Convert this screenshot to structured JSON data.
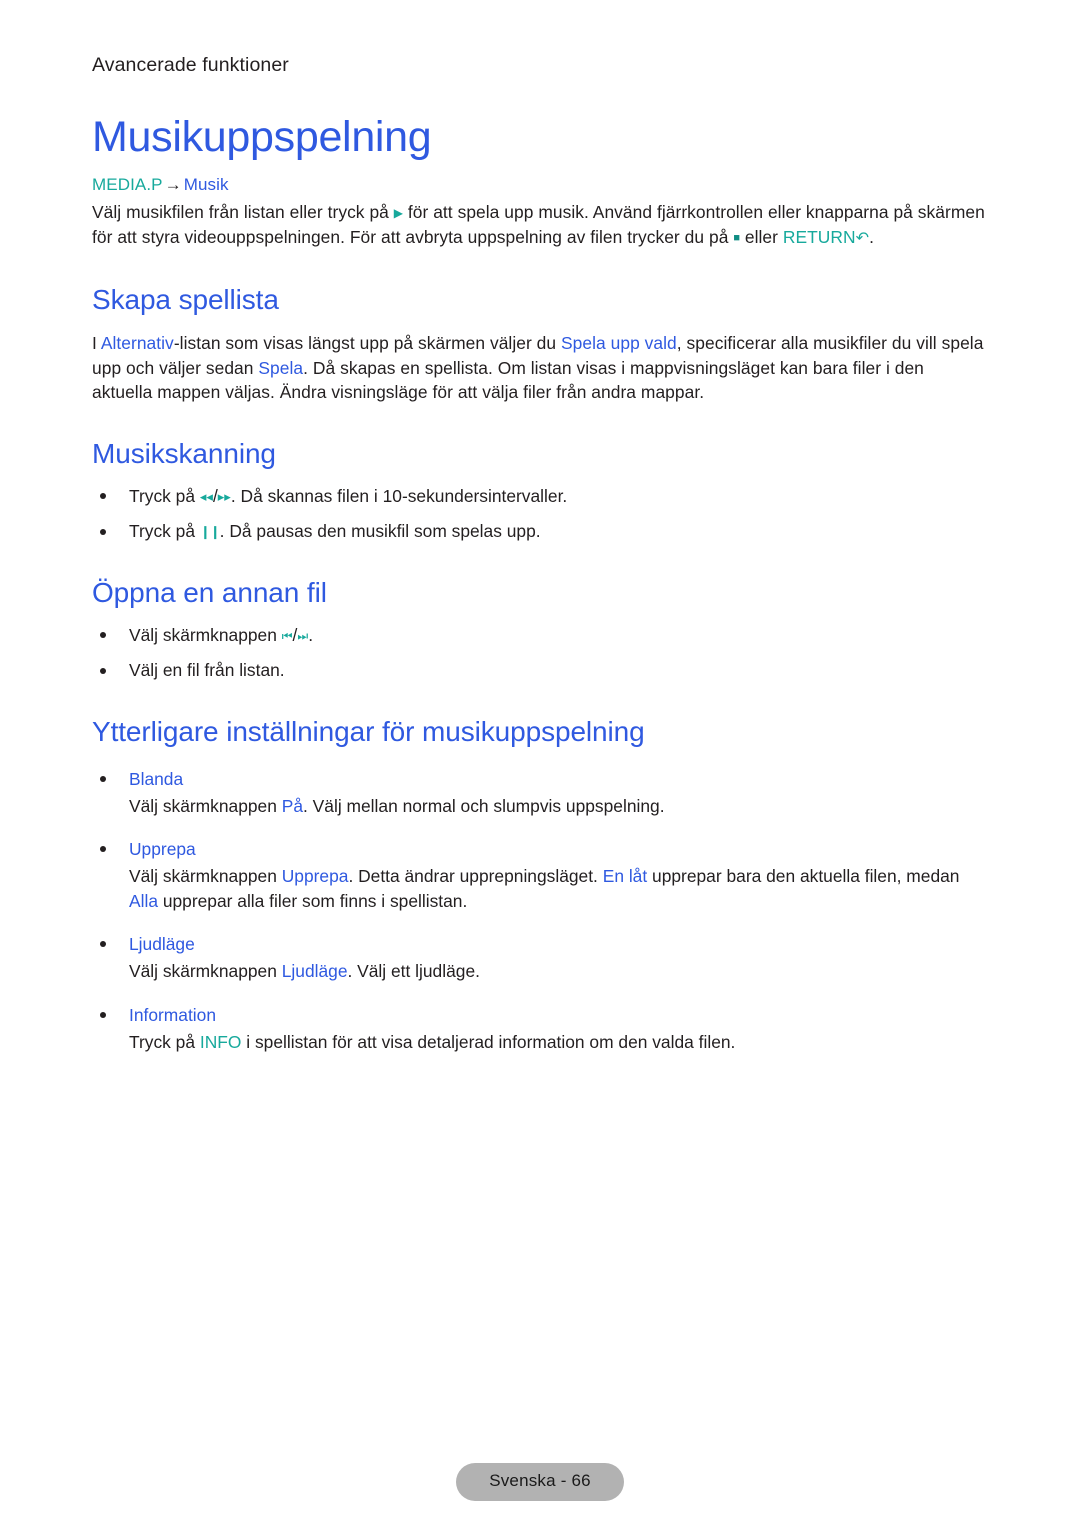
{
  "header": {
    "running_head": "Avancerade funktioner"
  },
  "doc": {
    "title": "Musikuppspelning"
  },
  "path": {
    "key": "MEDIA.P",
    "arrow": "→",
    "target": "Musik"
  },
  "intro": {
    "part1": "Välj musikfilen från listan eller tryck på ",
    "play_icon": "▶",
    "part2": " för att spela upp musik. Använd fjärrkontrollen eller knapparna på skärmen för att styra videouppspelningen. För att avbryta uppspelning av filen trycker du på ",
    "stop_icon": "■",
    "part3": " eller ",
    "return_label": "RETURN",
    "return_icon": "↶",
    "part4": "."
  },
  "sections": {
    "playlist": {
      "heading": "Skapa spellista",
      "p1": "I ",
      "link1": "Alternativ",
      "p2": "-listan som visas längst upp på skärmen väljer du ",
      "link2": "Spela upp vald",
      "p3": ", specificerar alla musikfiler du vill spela upp och väljer sedan ",
      "link3": "Spela",
      "p4": ". Då skapas en spellista. Om listan visas i mappvisningsläget kan bara filer i den aktuella mappen väljas. Ändra visningsläge för att välja filer från andra mappar."
    },
    "scanning": {
      "heading": "Musikskanning",
      "bullets": [
        {
          "pre": "Tryck på ",
          "icon_a": "◂◂",
          "sep": "/",
          "icon_b": "▸▸",
          "post": ". Då skannas filen i 10-sekundersintervaller."
        },
        {
          "pre": "Tryck på ",
          "icon_a": "❙❙",
          "sep": "",
          "icon_b": "",
          "post": ". Då pausas den musikfil som spelas upp."
        }
      ]
    },
    "openfile": {
      "heading": "Öppna en annan fil",
      "bullets": [
        {
          "pre": "Välj skärmknappen ",
          "icon_a": "⏮",
          "sep": "/",
          "icon_b": "⏭",
          "post": "."
        },
        {
          "pre": "Välj en fil från listan.",
          "icon_a": "",
          "sep": "",
          "icon_b": "",
          "post": ""
        }
      ]
    },
    "more_settings": {
      "heading": "Ytterligare inställningar för musikuppspelning",
      "items": [
        {
          "term": "Blanda",
          "desc_pre": "Välj skärmknappen ",
          "desc_link1": "På",
          "desc_mid": ". Välj mellan normal och slumpvis uppspelning.",
          "desc_link2": "",
          "desc_mid2": "",
          "desc_link3": "",
          "desc_post": ""
        },
        {
          "term": "Upprepa",
          "desc_pre": "Välj skärmknappen ",
          "desc_link1": "Upprepa",
          "desc_mid": ". Detta ändrar upprepningsläget. ",
          "desc_link2": "En låt",
          "desc_mid2": " upprepar bara den aktuella filen, medan ",
          "desc_link3": "Alla",
          "desc_post": " upprepar alla filer som finns i spellistan."
        },
        {
          "term": "Ljudläge",
          "desc_pre": "Välj skärmknappen ",
          "desc_link1": "Ljudläge",
          "desc_mid": ". Välj ett ljudläge.",
          "desc_link2": "",
          "desc_mid2": "",
          "desc_link3": "",
          "desc_post": ""
        },
        {
          "term": "Information",
          "desc_pre": "Tryck på ",
          "desc_link1": "INFO",
          "desc_mid": " i spellistan för att visa detaljerad information om den valda filen.",
          "desc_link2": "",
          "desc_mid2": "",
          "desc_link3": "",
          "desc_post": ""
        }
      ]
    }
  },
  "footer": {
    "page_label": "Svenska - 66"
  },
  "colors": {
    "heading_blue": "#2f59e0",
    "remote_teal": "#17a99c",
    "body_text": "#231f20",
    "footer_pill": "#b2b2b2"
  }
}
